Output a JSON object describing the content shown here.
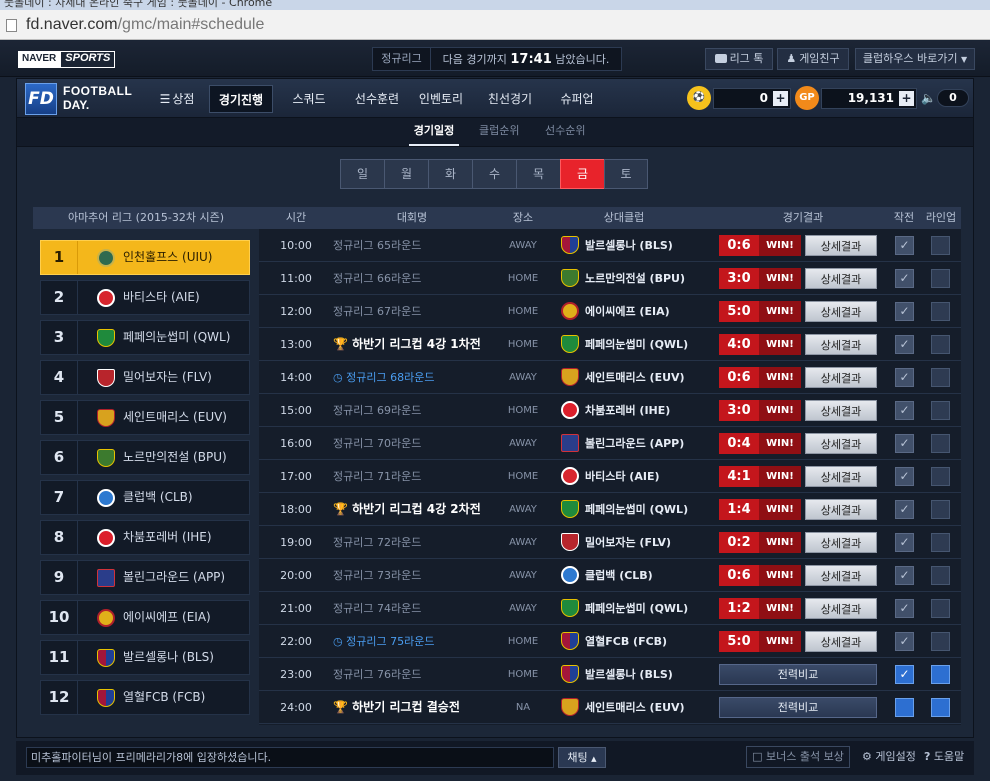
{
  "browser": {
    "title": "풋볼데이 : 차세대 온라인 축구 게임 : 풋볼데이 - Chrome",
    "url_host": "fd.naver.com",
    "url_path": "/gmc/main#schedule"
  },
  "topbar": {
    "naver": "NAVER",
    "sports": "SPORTS",
    "league_tag": "정규리그",
    "notice_prefix": "다음 경기까지",
    "notice_time": "17:41",
    "notice_suffix": "남았습니다.",
    "btn_talk": "리그 톡",
    "btn_friends": "게임친구",
    "btn_clubhouse": "클럽하우스 바로가기"
  },
  "logo": {
    "line1": "FOOTBALL",
    "line2": "DAY."
  },
  "menu": [
    {
      "label": "상점"
    },
    {
      "label": "경기진행"
    },
    {
      "label": "스쿼드"
    },
    {
      "label": "선수훈련"
    },
    {
      "label": "인벤토리"
    },
    {
      "label": "친선경기"
    },
    {
      "label": "슈퍼업"
    }
  ],
  "currency": {
    "coin": "0",
    "gp_label": "GP",
    "gp": "19,131",
    "volume": "0",
    "plus": "+"
  },
  "subnav": [
    "경기일정",
    "클럽순위",
    "선수순위"
  ],
  "days": [
    "일",
    "월",
    "화",
    "수",
    "목",
    "금",
    "토"
  ],
  "standings": {
    "header": "아마추어 리그 (2015-32차 시즌)",
    "teams": [
      {
        "rank": "1",
        "name": "인천홀프스 (UIU)"
      },
      {
        "rank": "2",
        "name": "바티스타 (AIE)"
      },
      {
        "rank": "3",
        "name": "페페의눈썹미 (QWL)"
      },
      {
        "rank": "4",
        "name": "밀어보자는 (FLV)"
      },
      {
        "rank": "5",
        "name": "세인트매리스 (EUV)"
      },
      {
        "rank": "6",
        "name": "노르만의전설 (BPU)"
      },
      {
        "rank": "7",
        "name": "클럽백 (CLB)"
      },
      {
        "rank": "8",
        "name": "차붐포레버 (IHE)"
      },
      {
        "rank": "9",
        "name": "볼린그라운드 (APP)"
      },
      {
        "rank": "10",
        "name": "에이씨에프 (EIA)"
      },
      {
        "rank": "11",
        "name": "발르셀롱나 (BLS)"
      },
      {
        "rank": "12",
        "name": "열혈FCB (FCB)"
      }
    ]
  },
  "schedule": {
    "headers": {
      "time": "시간",
      "comp": "대회명",
      "venue": "장소",
      "opp": "상대클럽",
      "result": "경기결과",
      "tactic": "작전",
      "lineup": "라인업"
    },
    "win_label": "WIN!",
    "detail_label": "상세결과",
    "compare_label": "전력비교",
    "check_mark": "✓",
    "matches": [
      {
        "time": "10:00",
        "comp": "정규리그 65라운드",
        "venue": "AWAY",
        "opp": "발르셀롱나 (BLS)",
        "score": "0:6"
      },
      {
        "time": "11:00",
        "comp": "정규리그 66라운드",
        "venue": "HOME",
        "opp": "노르만의전설 (BPU)",
        "score": "3:0"
      },
      {
        "time": "12:00",
        "comp": "정규리그 67라운드",
        "venue": "HOME",
        "opp": "에이씨에프 (EIA)",
        "score": "5:0"
      },
      {
        "time": "13:00",
        "comp": "하반기 리그컵 4강 1차전",
        "venue": "HOME",
        "opp": "페페의눈썹미 (QWL)",
        "score": "4:0"
      },
      {
        "time": "14:00",
        "comp": "정규리그 68라운드",
        "venue": "AWAY",
        "opp": "세인트매리스 (EUV)",
        "score": "0:6"
      },
      {
        "time": "15:00",
        "comp": "정규리그 69라운드",
        "venue": "HOME",
        "opp": "차붐포레버 (IHE)",
        "score": "3:0"
      },
      {
        "time": "16:00",
        "comp": "정규리그 70라운드",
        "venue": "AWAY",
        "opp": "볼린그라운드 (APP)",
        "score": "0:4"
      },
      {
        "time": "17:00",
        "comp": "정규리그 71라운드",
        "venue": "HOME",
        "opp": "바티스타 (AIE)",
        "score": "4:1"
      },
      {
        "time": "18:00",
        "comp": "하반기 리그컵 4강 2차전",
        "venue": "AWAY",
        "opp": "페페의눈썹미 (QWL)",
        "score": "1:4"
      },
      {
        "time": "19:00",
        "comp": "정규리그 72라운드",
        "venue": "AWAY",
        "opp": "밀어보자는 (FLV)",
        "score": "0:2"
      },
      {
        "time": "20:00",
        "comp": "정규리그 73라운드",
        "venue": "AWAY",
        "opp": "클럽백 (CLB)",
        "score": "0:6"
      },
      {
        "time": "21:00",
        "comp": "정규리그 74라운드",
        "venue": "AWAY",
        "opp": "페페의눈썹미 (QWL)",
        "score": "1:2"
      },
      {
        "time": "22:00",
        "comp": "정규리그 75라운드",
        "venue": "HOME",
        "opp": "열혈FCB (FCB)",
        "score": "5:0"
      },
      {
        "time": "23:00",
        "comp": "정규리그 76라운드",
        "venue": "HOME",
        "opp": "발르셀롱나 (BLS)",
        "score": ""
      },
      {
        "time": "24:00",
        "comp": "하반기 리그컵 결승전",
        "venue": "NA",
        "opp": "세인트매리스 (EUV)",
        "score": ""
      }
    ]
  },
  "bottom": {
    "chat_message": "미추홀파이터님이 프리메라리가8에 입장하셨습니다.",
    "chat_button": "채팅",
    "bonus": "보너스 출석 보상",
    "settings": "게임설정",
    "help": "도움말"
  },
  "colors": {
    "accent_red": "#e8232b",
    "rank_gold": "#f4b71b",
    "link_blue": "#4a9df0"
  }
}
